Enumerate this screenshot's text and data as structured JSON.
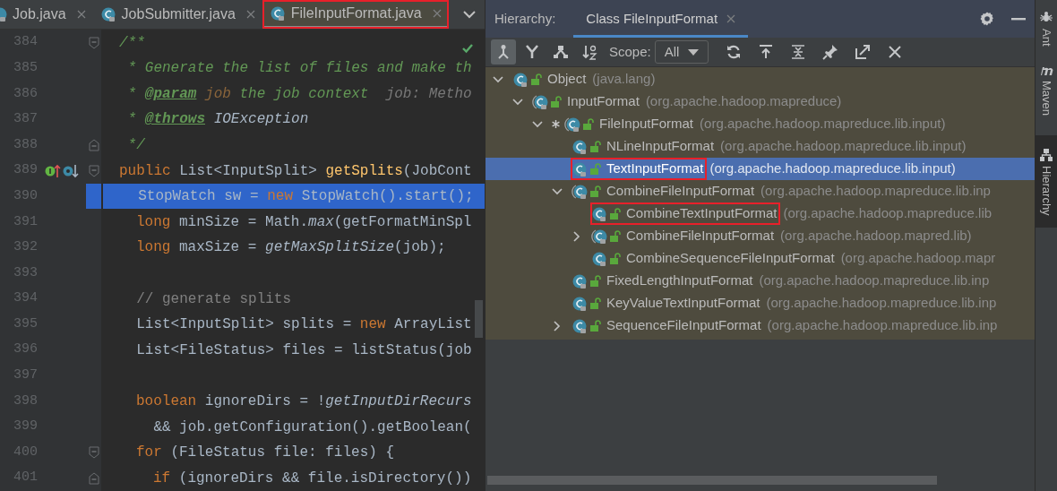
{
  "editor": {
    "tabs": [
      {
        "label": "Job.java",
        "selected": false,
        "annotated": false
      },
      {
        "label": "JobSubmitter.java",
        "selected": false,
        "annotated": false
      },
      {
        "label": "FileInputFormat.java",
        "selected": true,
        "annotated": true
      }
    ],
    "lines": [
      {
        "number": "384",
        "selected": false,
        "markers": [
          {
            "kind": "fold-start"
          }
        ],
        "tokens": [
          {
            "kind": "comment",
            "text": "/**"
          }
        ]
      },
      {
        "number": "385",
        "selected": false,
        "tokens": [
          {
            "kind": "comment",
            "text": " * Generate the list of files and make th"
          }
        ]
      },
      {
        "number": "386",
        "selected": false,
        "tokens": [
          {
            "kind": "comment",
            "text": " * "
          },
          {
            "kind": "doc-tag",
            "text": "@param"
          },
          {
            "kind": "doc-param",
            "text": " job"
          },
          {
            "kind": "comment",
            "text": " the job context"
          },
          {
            "kind": "hint",
            "text": "  job: Metho"
          }
        ]
      },
      {
        "number": "387",
        "selected": false,
        "tokens": [
          {
            "kind": "comment",
            "text": " * "
          },
          {
            "kind": "doc-tag",
            "text": "@throws"
          },
          {
            "kind": "doc-ref",
            "text": " IOException"
          }
        ]
      },
      {
        "number": "388",
        "selected": false,
        "markers": [
          {
            "kind": "fold-end"
          }
        ],
        "tokens": [
          {
            "kind": "comment",
            "text": " */"
          }
        ]
      },
      {
        "number": "389",
        "selected": false,
        "markers": [
          {
            "kind": "implemented"
          },
          {
            "kind": "overridden"
          },
          {
            "kind": "fold-start"
          }
        ],
        "tokens": [
          {
            "kind": "keyword",
            "text": "public"
          },
          {
            "kind": "plain",
            "text": " List<InputSplit> "
          },
          {
            "kind": "method-decl",
            "text": "getSplits"
          },
          {
            "kind": "plain",
            "text": "(JobCont"
          }
        ]
      },
      {
        "number": "390",
        "selected": true,
        "tokens": [
          {
            "kind": "plain",
            "text": "  StopWatch sw = "
          },
          {
            "kind": "keyword",
            "text": "new"
          },
          {
            "kind": "plain",
            "text": " StopWatch().start();"
          }
        ]
      },
      {
        "number": "391",
        "selected": false,
        "kind": "indented",
        "tokens": [
          {
            "kind": "keyword",
            "text": "long"
          },
          {
            "kind": "plain",
            "text": " minSize = Math."
          },
          {
            "kind": "static",
            "text": "max"
          },
          {
            "kind": "plain",
            "text": "(getFormatMinSpl"
          }
        ]
      },
      {
        "number": "392",
        "selected": false,
        "kind": "indented",
        "tokens": [
          {
            "kind": "keyword",
            "text": "long"
          },
          {
            "kind": "plain",
            "text": " maxSize = "
          },
          {
            "kind": "static",
            "text": "getMaxSplitSize"
          },
          {
            "kind": "plain",
            "text": "(job);"
          }
        ]
      },
      {
        "number": "393",
        "selected": false
      },
      {
        "number": "394",
        "selected": false,
        "tokens": [
          {
            "kind": "line-comment",
            "text": "  // generate splits"
          }
        ]
      },
      {
        "number": "395",
        "selected": false,
        "tokens": [
          {
            "kind": "plain",
            "text": "  List<InputSplit> splits = "
          },
          {
            "kind": "keyword",
            "text": "new"
          },
          {
            "kind": "plain",
            "text": " ArrayList"
          }
        ]
      },
      {
        "number": "396",
        "selected": false,
        "tokens": [
          {
            "kind": "plain",
            "text": "  List<FileStatus> files = listStatus(job"
          }
        ]
      },
      {
        "number": "397",
        "selected": false
      },
      {
        "number": "398",
        "selected": false,
        "kind": "indented",
        "tokens": [
          {
            "kind": "keyword",
            "text": "boolean"
          },
          {
            "kind": "plain",
            "text": " ignoreDirs = !"
          },
          {
            "kind": "static",
            "text": "getInputDirRecurs"
          }
        ]
      },
      {
        "number": "399",
        "selected": false,
        "tokens": [
          {
            "kind": "plain",
            "text": "    && job.getConfiguration().getBoolean("
          }
        ]
      },
      {
        "number": "400",
        "selected": false,
        "kind": "indented",
        "markers": [
          {
            "kind": "fold-start"
          }
        ],
        "tokens": [
          {
            "kind": "keyword",
            "text": "for"
          },
          {
            "kind": "plain",
            "text": " (FileStatus file: files) {"
          }
        ]
      },
      {
        "number": "401",
        "selected": false,
        "kind": "nested",
        "markers": [
          {
            "kind": "fold-end"
          }
        ],
        "tokens": [
          {
            "kind": "keyword",
            "text": "if"
          },
          {
            "kind": "plain",
            "text": " (ignoreDirs && file.isDirectory())"
          }
        ]
      }
    ]
  },
  "hierarchy": {
    "title": "Hierarchy:",
    "tab": {
      "label": "Class FileInputFormat",
      "selected": true
    },
    "toolbar": {
      "view_buttons": [
        {
          "kind": "subtypes",
          "selected": true
        },
        {
          "kind": "supertypes",
          "selected": false
        },
        {
          "kind": "class-hierarchy",
          "selected": false
        },
        {
          "kind": "sort",
          "selected": false
        }
      ],
      "scope_label": "Scope:",
      "scope_value": "All",
      "actions": [
        {
          "kind": "refresh"
        },
        {
          "kind": "export"
        },
        {
          "kind": "expand"
        },
        {
          "kind": "pin"
        },
        {
          "kind": "open"
        },
        {
          "kind": "close"
        }
      ]
    },
    "tree": [
      {
        "name": "Object",
        "package": "(java.lang)",
        "expanded": true,
        "abstract": false,
        "marked": false,
        "selected": false,
        "annotated": false,
        "children": [
          {
            "name": "InputFormat",
            "package": "(org.apache.hadoop.mapreduce)",
            "expanded": true,
            "abstract": true,
            "marked": false,
            "selected": false,
            "annotated": false,
            "children": [
              {
                "name": "FileInputFormat",
                "package": "(org.apache.hadoop.mapreduce.lib.input)",
                "expanded": true,
                "abstract": true,
                "marked": true,
                "selected": false,
                "annotated": false,
                "children": [
                  {
                    "name": "NLineInputFormat",
                    "package": "(org.apache.hadoop.mapreduce.lib.input)",
                    "abstract": false,
                    "marked": false,
                    "selected": false,
                    "annotated": false
                  },
                  {
                    "name": "TextInputFormat",
                    "package": "(org.apache.hadoop.mapreduce.lib.input)",
                    "abstract": false,
                    "marked": false,
                    "selected": true,
                    "annotated": true
                  },
                  {
                    "name": "CombineFileInputFormat",
                    "package": "(org.apache.hadoop.mapreduce.lib.inp",
                    "expanded": true,
                    "abstract": true,
                    "marked": false,
                    "selected": false,
                    "annotated": false,
                    "children": [
                      {
                        "name": "CombineTextInputFormat",
                        "package": "(org.apache.hadoop.mapreduce.lib",
                        "abstract": false,
                        "marked": false,
                        "selected": false,
                        "annotated": true
                      },
                      {
                        "name": "CombineFileInputFormat",
                        "package": "(org.apache.hadoop.mapred.lib)",
                        "expanded": false,
                        "abstract": true,
                        "marked": false,
                        "selected": false,
                        "annotated": false
                      },
                      {
                        "name": "CombineSequenceFileInputFormat",
                        "package": "(org.apache.hadoop.mapr",
                        "abstract": false,
                        "marked": false,
                        "selected": false,
                        "annotated": false
                      }
                    ]
                  },
                  {
                    "name": "FixedLengthInputFormat",
                    "package": "(org.apache.hadoop.mapreduce.lib.inp",
                    "abstract": false,
                    "marked": false,
                    "selected": false,
                    "annotated": false
                  },
                  {
                    "name": "KeyValueTextInputFormat",
                    "package": "(org.apache.hadoop.mapreduce.lib.inp",
                    "abstract": false,
                    "marked": false,
                    "selected": false,
                    "annotated": false
                  },
                  {
                    "name": "SequenceFileInputFormat",
                    "package": "(org.apache.hadoop.mapreduce.lib.inp",
                    "expanded": false,
                    "abstract": false,
                    "marked": false,
                    "selected": false,
                    "annotated": false
                  }
                ]
              }
            ]
          }
        ]
      }
    ]
  },
  "side_tools": [
    {
      "label": "Ant",
      "kind": "ant",
      "selected": false
    },
    {
      "label": "Maven",
      "kind": "maven",
      "selected": false
    },
    {
      "label": "Hierarchy",
      "kind": "hierarchy",
      "selected": true
    }
  ]
}
